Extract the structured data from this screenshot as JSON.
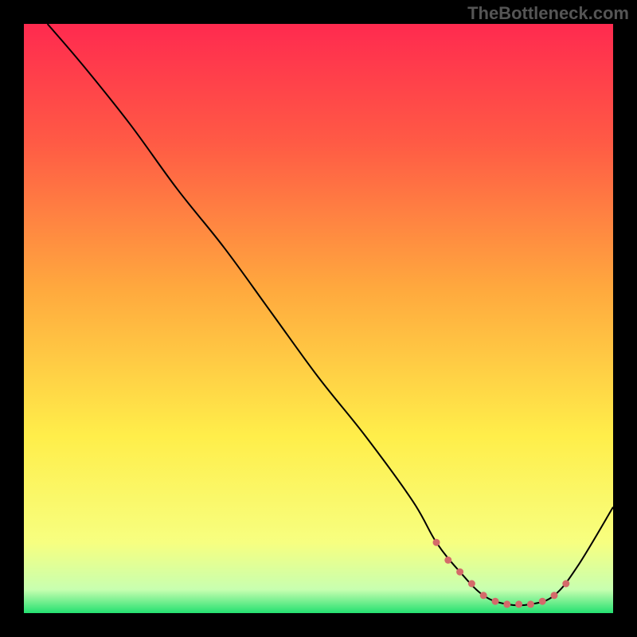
{
  "watermark": "TheBottleneck.com",
  "chart_data": {
    "type": "line",
    "title": "",
    "xlabel": "",
    "ylabel": "",
    "xlim": [
      0,
      100
    ],
    "ylim": [
      0,
      100
    ],
    "gradient_stops": [
      {
        "offset": 0,
        "color": "#ff2a4f"
      },
      {
        "offset": 20,
        "color": "#ff5a45"
      },
      {
        "offset": 45,
        "color": "#ffa93e"
      },
      {
        "offset": 70,
        "color": "#ffee4a"
      },
      {
        "offset": 88,
        "color": "#f7ff80"
      },
      {
        "offset": 96,
        "color": "#c8ffb0"
      },
      {
        "offset": 100,
        "color": "#24e070"
      }
    ],
    "series": [
      {
        "name": "bottleneck-curve",
        "stroke": "#000000",
        "x": [
          4,
          10,
          18,
          26,
          34,
          42,
          50,
          58,
          66,
          70,
          74,
          78,
          82,
          86,
          90,
          94,
          100
        ],
        "y": [
          100,
          93,
          83,
          72,
          62,
          51,
          40,
          30,
          19,
          12,
          7,
          3,
          1.5,
          1.5,
          3,
          8,
          18
        ]
      },
      {
        "name": "highlight-band",
        "stroke": "#d46a6a",
        "width": 9,
        "x": [
          70,
          72,
          74,
          76,
          78,
          80,
          82,
          84,
          86,
          88,
          90,
          92
        ],
        "y": [
          12,
          9,
          7,
          5,
          3,
          2,
          1.5,
          1.5,
          1.5,
          2,
          3,
          5
        ]
      }
    ]
  }
}
